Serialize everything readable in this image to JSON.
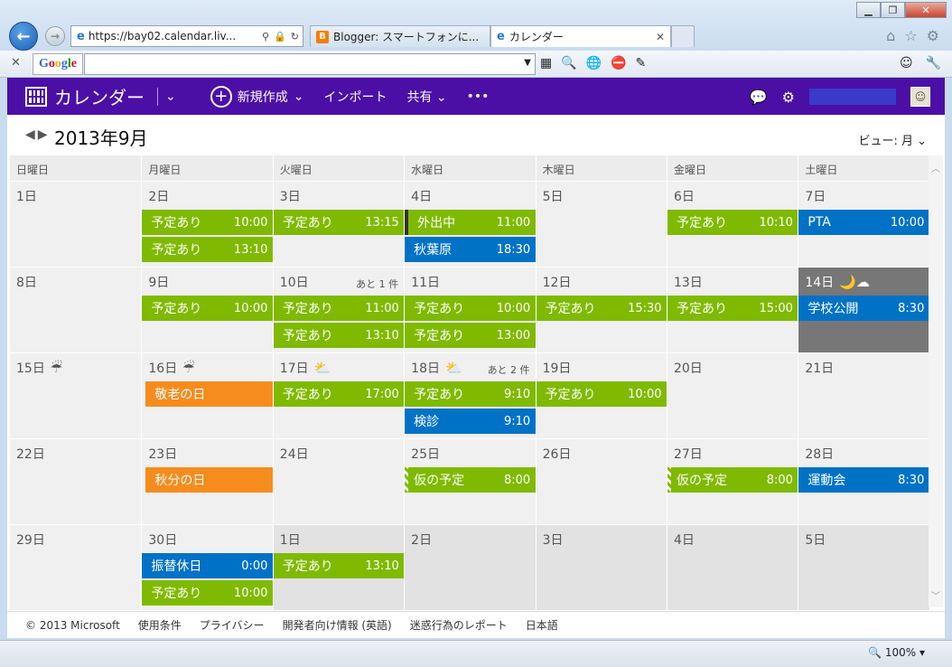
{
  "browser": {
    "window_title": "",
    "address": "https://bay02.calendar.liv...",
    "tabs": [
      {
        "label": "Blogger: スマートフォンに..."
      },
      {
        "label": "カレンダー"
      }
    ],
    "google_logo": "Google",
    "zoom": "100%"
  },
  "app": {
    "title": "カレンダー",
    "new_label": "新規作成",
    "import_label": "インポート",
    "share_label": "共有",
    "more_label": "•••",
    "month_title": "2013年9月",
    "view_label": "ビュー: 月"
  },
  "weekdays": [
    "日曜日",
    "月曜日",
    "火曜日",
    "水曜日",
    "木曜日",
    "金曜日",
    "土曜日"
  ],
  "weeks": [
    [
      {
        "day": "1日",
        "events": []
      },
      {
        "day": "2日",
        "events": [
          {
            "title": "予定あり",
            "time": "10:00",
            "color": "green"
          },
          {
            "title": "予定あり",
            "time": "13:10",
            "color": "green"
          }
        ]
      },
      {
        "day": "3日",
        "events": [
          {
            "title": "予定あり",
            "time": "13:15",
            "color": "green"
          }
        ]
      },
      {
        "day": "4日",
        "events": [
          {
            "title": "外出中",
            "time": "11:00",
            "color": "green",
            "outline": true
          },
          {
            "title": "秋葉原",
            "time": "18:30",
            "color": "blue"
          }
        ]
      },
      {
        "day": "5日",
        "events": []
      },
      {
        "day": "6日",
        "events": [
          {
            "title": "予定あり",
            "time": "10:10",
            "color": "green"
          }
        ]
      },
      {
        "day": "7日",
        "events": [
          {
            "title": "PTA",
            "time": "10:00",
            "color": "blue"
          }
        ]
      }
    ],
    [
      {
        "day": "8日",
        "events": []
      },
      {
        "day": "9日",
        "events": [
          {
            "title": "予定あり",
            "time": "10:00",
            "color": "green"
          }
        ]
      },
      {
        "day": "10日",
        "more": "あと 1 件",
        "events": [
          {
            "title": "予定あり",
            "time": "11:00",
            "color": "green"
          },
          {
            "title": "予定あり",
            "time": "13:10",
            "color": "green"
          }
        ]
      },
      {
        "day": "11日",
        "events": [
          {
            "title": "予定あり",
            "time": "10:00",
            "color": "green"
          },
          {
            "title": "予定あり",
            "time": "13:00",
            "color": "green"
          }
        ]
      },
      {
        "day": "12日",
        "events": [
          {
            "title": "予定あり",
            "time": "15:30",
            "color": "green"
          }
        ]
      },
      {
        "day": "13日",
        "events": [
          {
            "title": "予定あり",
            "time": "15:00",
            "color": "green"
          }
        ]
      },
      {
        "day": "14日",
        "weather": "🌙☁",
        "dark": true,
        "events": [
          {
            "title": "学校公開",
            "time": "8:30",
            "color": "blue"
          }
        ]
      }
    ],
    [
      {
        "day": "15日",
        "weather": "☔",
        "events": []
      },
      {
        "day": "16日",
        "weather": "☔",
        "events": [
          {
            "title": "敬老の日",
            "time": "",
            "color": "orange"
          }
        ]
      },
      {
        "day": "17日",
        "weather": "⛅",
        "events": [
          {
            "title": "予定あり",
            "time": "17:00",
            "color": "green"
          }
        ]
      },
      {
        "day": "18日",
        "weather": "⛅",
        "more": "あと 2 件",
        "events": [
          {
            "title": "予定あり",
            "time": "9:10",
            "color": "green"
          },
          {
            "title": "検診",
            "time": "9:10",
            "color": "blue"
          }
        ]
      },
      {
        "day": "19日",
        "events": [
          {
            "title": "予定あり",
            "time": "10:00",
            "color": "green"
          }
        ]
      },
      {
        "day": "20日",
        "events": []
      },
      {
        "day": "21日",
        "events": []
      }
    ],
    [
      {
        "day": "22日",
        "events": []
      },
      {
        "day": "23日",
        "events": [
          {
            "title": "秋分の日",
            "time": "",
            "color": "orange"
          }
        ]
      },
      {
        "day": "24日",
        "events": []
      },
      {
        "day": "25日",
        "events": [
          {
            "title": "仮の予定",
            "time": "8:00",
            "color": "striped"
          }
        ]
      },
      {
        "day": "26日",
        "events": []
      },
      {
        "day": "27日",
        "events": [
          {
            "title": "仮の予定",
            "time": "8:00",
            "color": "striped"
          }
        ]
      },
      {
        "day": "28日",
        "events": [
          {
            "title": "運動会",
            "time": "8:30",
            "color": "blue"
          }
        ]
      }
    ],
    [
      {
        "day": "29日",
        "events": []
      },
      {
        "day": "30日",
        "events": [
          {
            "title": "振替休日",
            "time": "0:00",
            "color": "blue"
          },
          {
            "title": "予定あり",
            "time": "10:00",
            "color": "green"
          }
        ]
      },
      {
        "day": "1日",
        "other": true,
        "events": [
          {
            "title": "予定あり",
            "time": "13:10",
            "color": "green"
          }
        ]
      },
      {
        "day": "2日",
        "other": true,
        "events": []
      },
      {
        "day": "3日",
        "other": true,
        "events": []
      },
      {
        "day": "4日",
        "other": true,
        "events": []
      },
      {
        "day": "5日",
        "other": true,
        "events": []
      }
    ]
  ],
  "footer": [
    "© 2013 Microsoft",
    "使用条件",
    "プライバシー",
    "開発者向け情報 (英語)",
    "迷惑行為のレポート",
    "日本語"
  ]
}
